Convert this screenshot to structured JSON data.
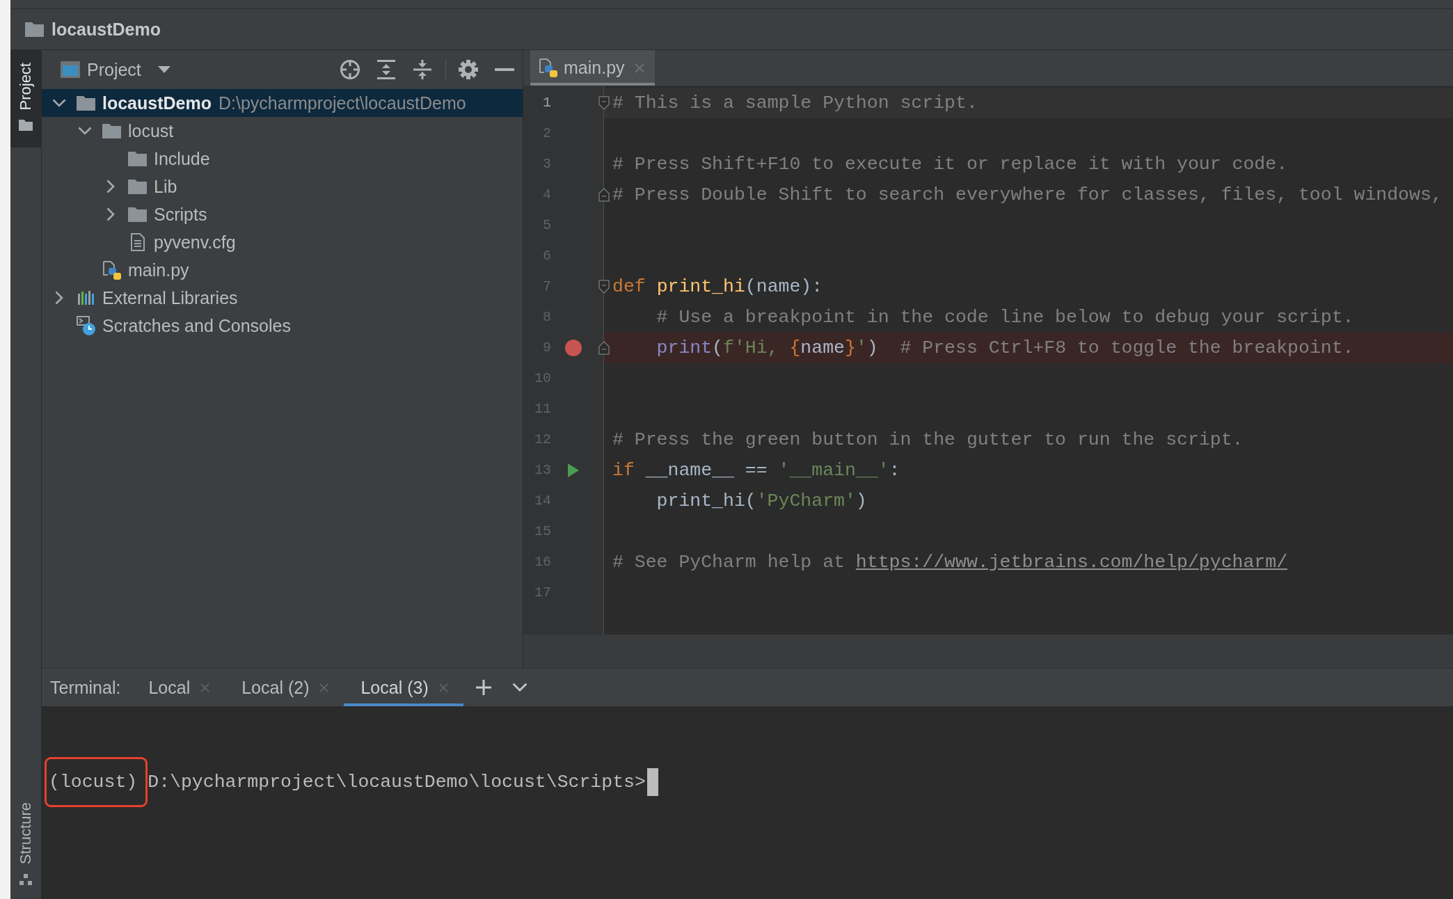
{
  "title_bar": {
    "project": "locaustDemo"
  },
  "tool_strip": {
    "top": [
      {
        "label": "Project",
        "kind": "folder",
        "selected": true
      }
    ],
    "bottom": [
      {
        "label": "Structure",
        "kind": "structure",
        "selected": false
      }
    ]
  },
  "project_panel": {
    "title": "Project",
    "tree": [
      {
        "label": "locaustDemo",
        "path": "D:\\pycharmproject\\locaustDemo",
        "kind": "project",
        "expanded": true,
        "selected": true,
        "children": [
          {
            "label": "locust",
            "kind": "folder",
            "expanded": true,
            "selected": false,
            "children": [
              {
                "label": "Include",
                "kind": "folder",
                "selected": false
              },
              {
                "label": "Lib",
                "kind": "folder",
                "expanded": false,
                "selected": false
              },
              {
                "label": "Scripts",
                "kind": "folder",
                "expanded": false,
                "selected": false
              },
              {
                "label": "pyvenv.cfg",
                "kind": "file",
                "selected": false
              }
            ]
          },
          {
            "label": "main.py",
            "kind": "python",
            "selected": false
          }
        ]
      },
      {
        "label": "External Libraries",
        "kind": "library",
        "expanded": false,
        "selected": false
      },
      {
        "label": "Scratches and Consoles",
        "kind": "scratch",
        "selected": false
      }
    ]
  },
  "editor": {
    "tabs": [
      {
        "label": "main.py",
        "selected": true
      }
    ],
    "lines": [
      {
        "number": "1",
        "current": true,
        "breakpoint": false,
        "runnable": false,
        "fold_open": true,
        "fold_close": false,
        "indented": false,
        "tokens": [
          {
            "text": "# This is a sample Python script.",
            "kind": "comment"
          }
        ]
      },
      {
        "number": "2",
        "current": false,
        "breakpoint": false,
        "runnable": false,
        "fold_open": false,
        "fold_close": false
      },
      {
        "number": "3",
        "current": false,
        "breakpoint": false,
        "runnable": false,
        "fold_open": false,
        "fold_close": false,
        "indented": false,
        "tokens": [
          {
            "text": "# Press Shift+F10 to execute it or replace it with your code.",
            "kind": "comment"
          }
        ]
      },
      {
        "number": "4",
        "current": false,
        "breakpoint": false,
        "runnable": false,
        "fold_open": false,
        "fold_close": true,
        "indented": false,
        "tokens": [
          {
            "text": "# Press Double Shift to search everywhere for classes, files, tool windows,",
            "kind": "comment"
          }
        ]
      },
      {
        "number": "5",
        "current": false,
        "breakpoint": false,
        "runnable": false,
        "fold_open": false,
        "fold_close": false
      },
      {
        "number": "6",
        "current": false,
        "breakpoint": false,
        "runnable": false,
        "fold_open": false,
        "fold_close": false
      },
      {
        "number": "7",
        "current": false,
        "breakpoint": false,
        "runnable": false,
        "fold_open": true,
        "fold_close": false,
        "indented": false,
        "tokens": [
          {
            "text": "def ",
            "kind": "keyword"
          },
          {
            "text": "print_hi",
            "kind": "function"
          },
          {
            "text": "(name):",
            "kind": "plain"
          }
        ]
      },
      {
        "number": "8",
        "current": false,
        "breakpoint": false,
        "runnable": false,
        "fold_open": false,
        "fold_close": false,
        "indented": true,
        "tokens": [
          {
            "text": "# Use a breakpoint in the code line below to debug your script.",
            "kind": "comment"
          }
        ]
      },
      {
        "number": "9",
        "current": false,
        "breakpoint": true,
        "runnable": false,
        "fold_open": false,
        "fold_close": true,
        "indented": true,
        "tokens": [
          {
            "text": "print",
            "kind": "builtin"
          },
          {
            "text": "(",
            "kind": "plain"
          },
          {
            "text": "f'Hi, ",
            "kind": "string"
          },
          {
            "text": "{",
            "kind": "brace"
          },
          {
            "text": "name",
            "kind": "plain"
          },
          {
            "text": "}",
            "kind": "brace"
          },
          {
            "text": "'",
            "kind": "string"
          },
          {
            "text": ")",
            "kind": "plain"
          },
          {
            "text": "  # Press Ctrl+F8 to toggle the breakpoint.",
            "kind": "comment"
          }
        ]
      },
      {
        "number": "10",
        "current": false,
        "breakpoint": false,
        "runnable": false,
        "fold_open": false,
        "fold_close": false
      },
      {
        "number": "11",
        "current": false,
        "breakpoint": false,
        "runnable": false,
        "fold_open": false,
        "fold_close": false
      },
      {
        "number": "12",
        "current": false,
        "breakpoint": false,
        "runnable": false,
        "fold_open": false,
        "fold_close": false,
        "indented": false,
        "tokens": [
          {
            "text": "# Press the green button in the gutter to run the script.",
            "kind": "comment"
          }
        ]
      },
      {
        "number": "13",
        "current": false,
        "breakpoint": false,
        "runnable": true,
        "fold_open": false,
        "fold_close": false,
        "indented": false,
        "tokens": [
          {
            "text": "if",
            "kind": "keyword"
          },
          {
            "text": " __name__ == ",
            "kind": "plain"
          },
          {
            "text": "'__main__'",
            "kind": "string"
          },
          {
            "text": ":",
            "kind": "plain"
          }
        ]
      },
      {
        "number": "14",
        "current": false,
        "breakpoint": false,
        "runnable": false,
        "fold_open": false,
        "fold_close": false,
        "indented": true,
        "tokens": [
          {
            "text": "print_hi(",
            "kind": "plain"
          },
          {
            "text": "'PyCharm'",
            "kind": "string"
          },
          {
            "text": ")",
            "kind": "plain"
          }
        ]
      },
      {
        "number": "15",
        "current": false,
        "breakpoint": false,
        "runnable": false,
        "fold_open": false,
        "fold_close": false
      },
      {
        "number": "16",
        "current": false,
        "breakpoint": false,
        "runnable": false,
        "fold_open": false,
        "fold_close": false,
        "indented": false,
        "tokens": [
          {
            "text": "# See PyCharm help at ",
            "kind": "comment"
          },
          {
            "text": "https://www.jetbrains.com/help/pycharm/",
            "kind": "link"
          }
        ]
      },
      {
        "number": "17",
        "current": false,
        "breakpoint": false,
        "runnable": false,
        "fold_open": false,
        "fold_close": false
      }
    ]
  },
  "terminal": {
    "title": "Terminal:",
    "tabs": [
      {
        "label": "Local",
        "selected": false
      },
      {
        "label": "Local (2)",
        "selected": false
      },
      {
        "label": "Local (3)",
        "selected": true
      }
    ],
    "prompt": {
      "env": "(locust)",
      "env_highlighted": true,
      "path": "D:\\pycharmproject\\locaustDemo\\locust\\Scripts>",
      "cursor": true
    }
  }
}
